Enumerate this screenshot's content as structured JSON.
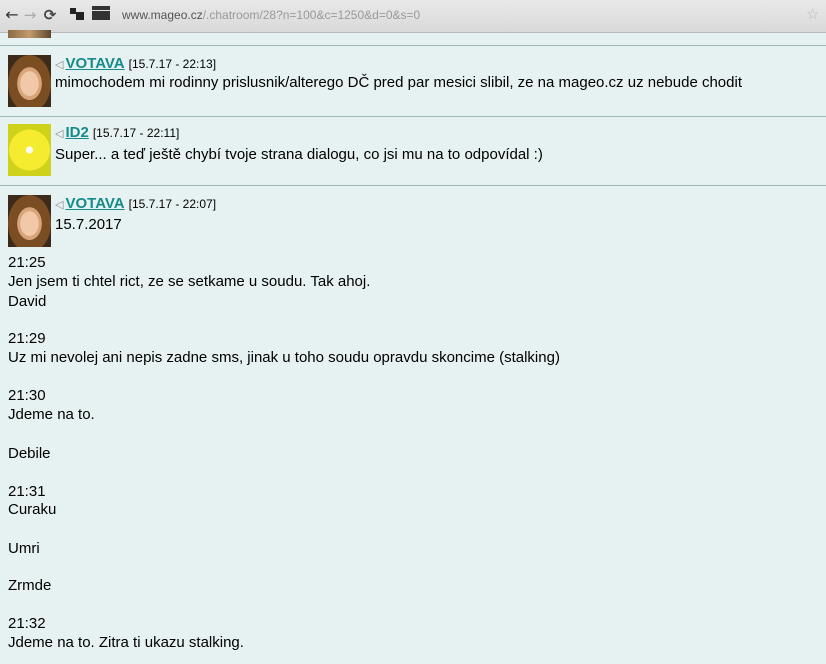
{
  "browser": {
    "url_host": "www.mageo.cz",
    "url_path": "/.chatroom/28?n=100&c=1250&d=0&s=0"
  },
  "posts": [
    {
      "author": "VOTAVA",
      "timestamp": "[15.7.17 - 22:13]",
      "text": "mimochodem mi rodinny prislusnik/alterego DČ pred par mesici slibil, ze na mageo.cz uz nebude chodit"
    },
    {
      "author": "ID2",
      "timestamp": "[15.7.17 - 22:11]",
      "text": "Super... a teď ještě chybí tvoje strana dialogu, co jsi mu na to odpovídal :)"
    },
    {
      "author": "VOTAVA",
      "timestamp": "[15.7.17 - 22:07]",
      "text": "15.7.2017",
      "lines": [
        "21:25",
        "Jen jsem ti chtel rict, ze se setkame u soudu. Tak ahoj.",
        "David",
        "21:29",
        "Uz mi nevolej ani nepis zadne sms, jinak u toho soudu opravdu skoncime (stalking)",
        "21:30",
        "Jdeme na to.",
        "Debile",
        "21:31",
        "Curaku",
        "Umri",
        "Zrmde",
        "21:32",
        "Jdeme na to. Zitra ti ukazu stalking."
      ]
    }
  ]
}
